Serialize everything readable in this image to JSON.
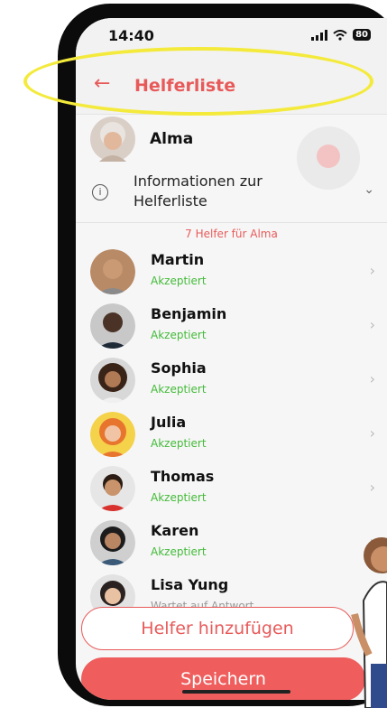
{
  "status_bar": {
    "time": "14:40",
    "battery": "80"
  },
  "header": {
    "back_icon": "arrow-left-icon",
    "title": "Helferliste"
  },
  "owner": {
    "name": "Alma"
  },
  "info": {
    "text": "Informationen zur Helferliste",
    "icon": "info-icon",
    "chevron": "chevron-down-icon"
  },
  "helper_count": "7 Helfer für Alma",
  "helpers": [
    {
      "name": "Martin",
      "status": "Akzeptiert"
    },
    {
      "name": "Benjamin",
      "status": "Akzeptiert"
    },
    {
      "name": "Sophia",
      "status": "Akzeptiert"
    },
    {
      "name": "Julia",
      "status": "Akzeptiert"
    },
    {
      "name": "Thomas",
      "status": "Akzeptiert"
    },
    {
      "name": "Karen",
      "status": "Akzeptiert"
    },
    {
      "name": "Lisa Yung",
      "status": "Wartet auf Antwort"
    }
  ],
  "buttons": {
    "add": "Helfer hinzufügen",
    "save": "Speichern"
  },
  "colors": {
    "accent": "#e85a5a",
    "accepted": "#44bb3a",
    "highlight": "#f4ea3c"
  }
}
